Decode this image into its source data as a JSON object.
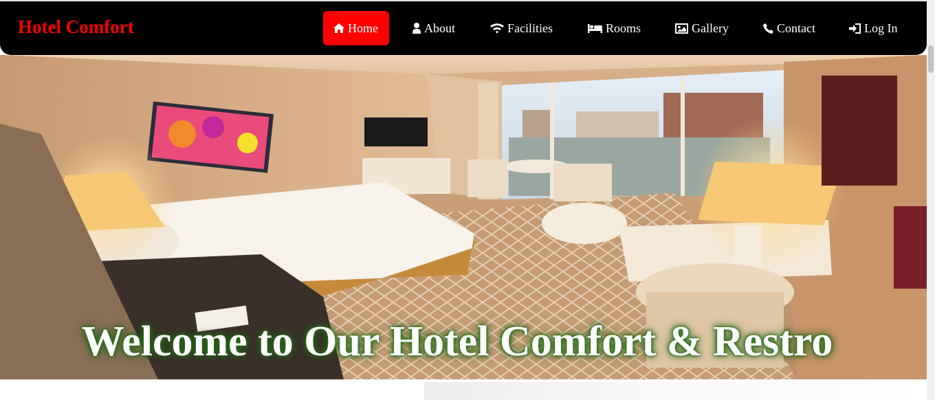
{
  "brand": "Hotel Comfort",
  "nav": [
    {
      "label": "Home",
      "icon": "home-icon",
      "active": true
    },
    {
      "label": "About",
      "icon": "user-icon",
      "active": false
    },
    {
      "label": "Facilities",
      "icon": "wifi-icon",
      "active": false
    },
    {
      "label": "Rooms",
      "icon": "bed-icon",
      "active": false
    },
    {
      "label": "Gallery",
      "icon": "image-icon",
      "active": false
    },
    {
      "label": "Contact",
      "icon": "phone-icon",
      "active": false
    },
    {
      "label": "Log In",
      "icon": "sign-in-icon",
      "active": false
    }
  ],
  "hero": {
    "headline": "Welcome to Our Hotel Comfort & Restro"
  },
  "colors": {
    "navbar_bg": "#000000",
    "brand": "#ff0000",
    "active_nav": "#ff0000",
    "headline_glow": "#2d7a1f"
  }
}
